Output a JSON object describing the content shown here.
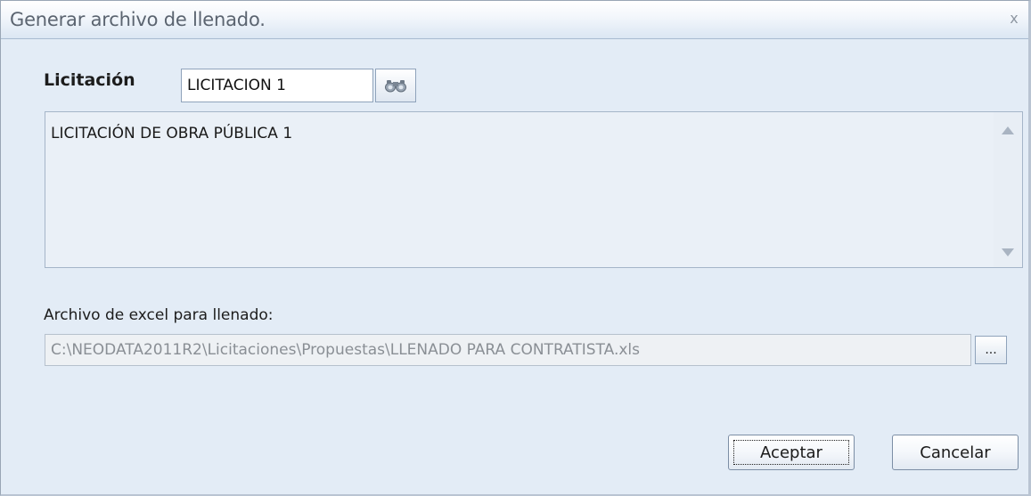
{
  "window": {
    "title": "Generar archivo de llenado.",
    "close_glyph": "x"
  },
  "licitacion": {
    "label": "Licitación",
    "value": "LICITACION 1",
    "search_icon": "binoculars-icon"
  },
  "description": {
    "text": "LICITACIÓN DE OBRA PÚBLICA 1"
  },
  "archivo": {
    "label": "Archivo de excel para llenado:",
    "path": "C:\\NEODATA2011R2\\Licitaciones\\Propuestas\\LLENADO PARA CONTRATISTA.xls",
    "browse_label": "..."
  },
  "buttons": {
    "accept_label": "Aceptar",
    "cancel_label": "Cancelar"
  },
  "colors": {
    "window_bg": "#e3ecf6",
    "title_text": "#5b6470",
    "border": "#8fa3bb"
  }
}
